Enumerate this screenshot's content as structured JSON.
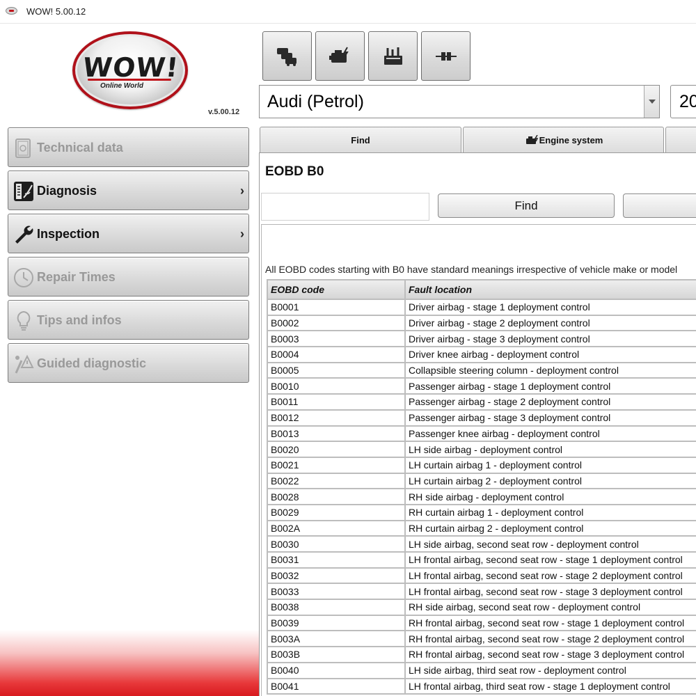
{
  "window": {
    "title": "WOW! 5.00.12"
  },
  "logo": {
    "wordmark": "WOW!",
    "tagline": "Online World",
    "version": "v.5.00.12"
  },
  "sidebar": {
    "items": [
      {
        "label": "Technical data",
        "enabled": false,
        "icon": "book-icon"
      },
      {
        "label": "Diagnosis",
        "enabled": true,
        "icon": "diagnosis-icon",
        "has_submenu": true
      },
      {
        "label": "Inspection",
        "enabled": true,
        "icon": "wrench-icon",
        "has_submenu": true
      },
      {
        "label": "Repair Times",
        "enabled": false,
        "icon": "clock-icon"
      },
      {
        "label": "Tips and infos",
        "enabled": false,
        "icon": "lightbulb-icon"
      },
      {
        "label": "Guided diagnostic",
        "enabled": false,
        "icon": "guided-diagnostic-icon"
      }
    ],
    "chevron": "›",
    "gradient_color": "#d8191e"
  },
  "toolbar": {
    "buttons": [
      {
        "icon": "vehicles-icon"
      },
      {
        "icon": "engine-icon"
      },
      {
        "icon": "toolbox-icon"
      },
      {
        "icon": "connector-icon"
      }
    ]
  },
  "vehicle": {
    "selected": "Audi (Petrol)",
    "year": "20"
  },
  "tabs": [
    {
      "label": "Find"
    },
    {
      "label": "Engine system",
      "icon": "engine-icon"
    },
    {
      "label": ""
    }
  ],
  "content": {
    "title": "EOBD B0",
    "search": {
      "value": "",
      "placeholder": ""
    },
    "find_label": "Find",
    "info": "All EOBD codes starting with B0 have standard meanings irrespective of vehicle make or model"
  },
  "table": {
    "headers": [
      "EOBD code",
      "Fault location"
    ],
    "rows": [
      [
        "B0001",
        "Driver airbag - stage 1 deployment control"
      ],
      [
        "B0002",
        "Driver airbag - stage 2 deployment control"
      ],
      [
        "B0003",
        "Driver airbag - stage 3 deployment control"
      ],
      [
        "B0004",
        "Driver knee airbag - deployment control"
      ],
      [
        "B0005",
        "Collapsible steering column - deployment control"
      ],
      [
        "B0010",
        "Passenger airbag - stage 1 deployment control"
      ],
      [
        "B0011",
        "Passenger airbag - stage 2 deployment control"
      ],
      [
        "B0012",
        "Passenger airbag - stage 3 deployment control"
      ],
      [
        "B0013",
        "Passenger knee airbag - deployment control"
      ],
      [
        "B0020",
        "LH side airbag - deployment control"
      ],
      [
        "B0021",
        "LH curtain airbag 1 - deployment control"
      ],
      [
        "B0022",
        "LH curtain airbag 2 - deployment control"
      ],
      [
        "B0028",
        "RH side airbag - deployment control"
      ],
      [
        "B0029",
        "RH curtain airbag 1 - deployment control"
      ],
      [
        "B002A",
        "RH curtain airbag 2 - deployment control"
      ],
      [
        "B0030",
        "LH side airbag, second seat row - deployment control"
      ],
      [
        "B0031",
        "LH frontal airbag, second seat row - stage 1 deployment control"
      ],
      [
        "B0032",
        "LH frontal airbag, second seat row - stage 2 deployment control"
      ],
      [
        "B0033",
        "LH frontal airbag, second seat row - stage 3 deployment control"
      ],
      [
        "B0038",
        "RH side airbag, second seat row - deployment control"
      ],
      [
        "B0039",
        "RH frontal airbag, second seat row - stage 1 deployment control"
      ],
      [
        "B003A",
        "RH frontal airbag, second seat row - stage 2 deployment control"
      ],
      [
        "B003B",
        "RH frontal airbag, second seat row - stage 3 deployment control"
      ],
      [
        "B0040",
        "LH side airbag, third seat row - deployment control"
      ],
      [
        "B0041",
        "LH frontal airbag, third seat row - stage 1 deployment control"
      ]
    ]
  }
}
